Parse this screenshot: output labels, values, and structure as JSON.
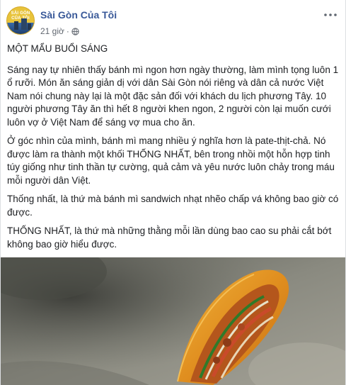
{
  "post": {
    "page_name": "Sài Gòn Của Tôi",
    "avatar_text": "SÀI GÒN CỦA TÔI",
    "timestamp": "21 giờ",
    "separator": "·",
    "privacy_icon": "globe-icon",
    "more_icon": "more-options-icon",
    "title": "MỘT MẨU BUỔI SÁNG",
    "paragraphs": [
      "Sáng nay tự nhiên thấy bánh mì ngon hơn ngày thường, làm mình tọng luôn 1 ổ rưỡi. Món ăn sáng giản dị với dân Sài Gòn nói riêng và dân cả nước Việt Nam nói chung này lại là một đặc sản đối với khách du lịch phương Tây. 10 người phương Tây ăn thì hết 8 người khen ngon, 2 người còn lại muốn cưới luôn vợ ở Việt Nam để sáng vợ mua cho ăn.",
      "Ở góc nhìn của mình, bánh mì mang nhiều ý nghĩa hơn là pate-thịt-chả. Nó được làm ra thành một khối THỐNG NHẤT, bên trong nhồi một hỗn hợp tinh túy giống như tinh thần tự cường, quả cảm và yêu nước luôn chảy trong máu mỗi người dân Việt.",
      "Thống nhất, là thứ mà bánh mì sandwich nhạt nhẽo chấp vá không bao giờ có được.",
      "THỐNG NHẤT, là thứ mà những thằng mỗi lần dùng bao cao su phải cắt bớt không bao giờ hiểu được."
    ],
    "photo": "banh-mi-photo"
  }
}
